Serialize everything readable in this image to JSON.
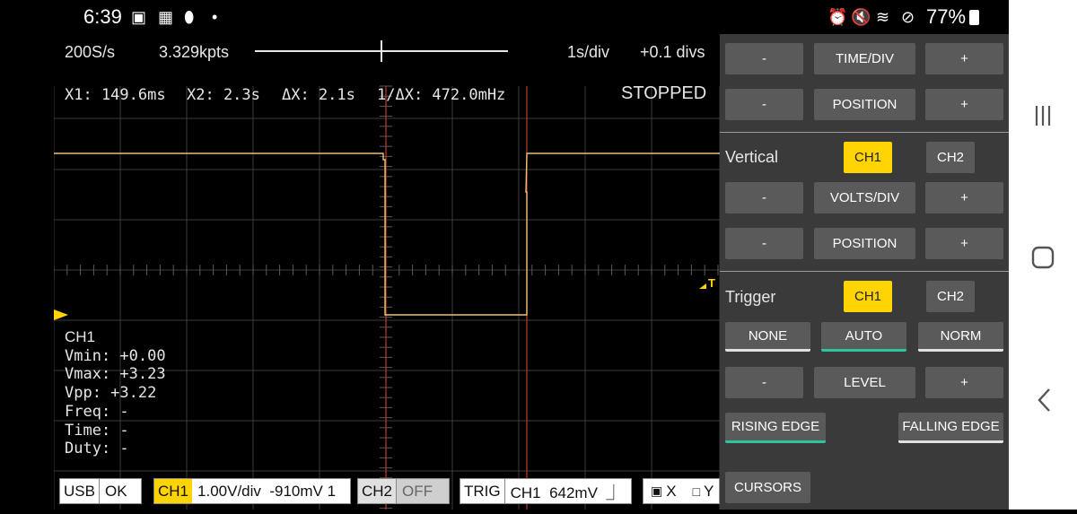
{
  "status_bar": {
    "time": "6:39",
    "battery": "77%",
    "icons": [
      "image-icon",
      "calendar-icon",
      "stylus-icon",
      "dot-icon",
      "alarm-icon",
      "mute-icon",
      "wifi-icon",
      "dnd-icon",
      "battery-icon"
    ]
  },
  "scope": {
    "sample_rate": "200S/s",
    "points": "3.329kpts",
    "time_div": "1s/div",
    "position": "+0.1 divs",
    "cursors": {
      "x1": "X1: 149.6ms",
      "x2": "X2: 2.3s",
      "dx": "ΔX: 2.1s",
      "inv_dx": "1/ΔX: 472.0mHz"
    },
    "state": "STOPPED",
    "trigger_marker": "T",
    "measurements": {
      "channel": "CH1",
      "vmin": "Vmin: +0.00",
      "vmax": "Vmax: +3.23",
      "vpp": "Vpp: +3.22",
      "freq": "Freq: -",
      "time": "Time: -",
      "duty": "Duty: -"
    },
    "bottom": {
      "usb_label": "USB",
      "usb_value": "OK",
      "ch1_label": "CH1",
      "ch1_value": "1.00V/div  -910mV 1",
      "ch2_label": "CH2",
      "ch2_value": "OFF",
      "trig_label": "TRIG",
      "trig_value": "CH1  642mV  ⏌",
      "x_label": "X",
      "y_label": "Y"
    },
    "colors": {
      "trace": "#e8c27a",
      "cursor": "#c0392b",
      "accent": "#ffd400",
      "grid": "#3c3c3c"
    }
  },
  "panel": {
    "minus": "-",
    "plus": "+",
    "time_div": "TIME/DIV",
    "position": "POSITION",
    "vertical_label": "Vertical",
    "ch1": "CH1",
    "ch2": "CH2",
    "volts_div": "VOLTS/DIV",
    "trigger_label": "Trigger",
    "mode_none": "NONE",
    "mode_auto": "AUTO",
    "mode_norm": "NORM",
    "level": "LEVEL",
    "rising_edge": "RISING EDGE",
    "falling_edge": "FALLING EDGE",
    "cursors": "CURSORS"
  }
}
